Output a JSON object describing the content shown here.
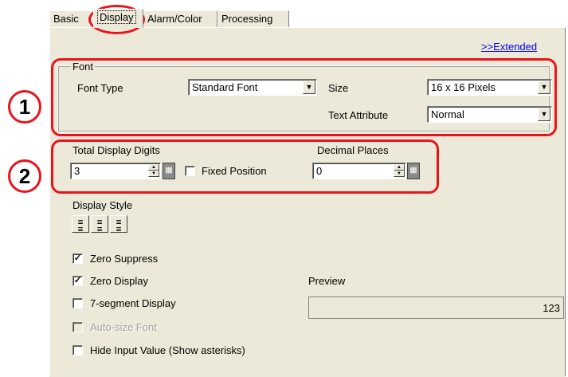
{
  "tabs": [
    {
      "label": "Basic"
    },
    {
      "label": "Display"
    },
    {
      "label": "Alarm/Color"
    },
    {
      "label": "Processing"
    }
  ],
  "extended_link": ">>Extended",
  "font_group": {
    "title": "Font",
    "font_type_label": "Font Type",
    "font_type_value": "Standard Font",
    "size_label": "Size",
    "size_value": "16 x 16 Pixels",
    "text_attribute_label": "Text Attribute",
    "text_attribute_value": "Normal"
  },
  "digits": {
    "total_label": "Total Display Digits",
    "total_value": "3",
    "fixed_position_label": "Fixed Position",
    "decimal_label": "Decimal Places",
    "decimal_value": "0"
  },
  "display_style": {
    "label": "Display Style"
  },
  "checkboxes": {
    "zero_suppress": {
      "label": "Zero Suppress",
      "checked": true
    },
    "zero_display": {
      "label": "Zero Display",
      "checked": true
    },
    "seven_segment": {
      "label": "7-segment Display",
      "checked": false
    },
    "auto_size_font": {
      "label": "Auto-size Font",
      "checked": false,
      "disabled": true
    },
    "hide_input": {
      "label": "Hide Input Value (Show asterisks)",
      "checked": false
    }
  },
  "preview": {
    "label": "Preview",
    "value": "123"
  },
  "callouts": {
    "one": "1",
    "two": "2"
  },
  "colors": {
    "callout_red": "#e8141e",
    "dialog_bg": "#ece9d8",
    "link_blue": "#0000ee"
  }
}
